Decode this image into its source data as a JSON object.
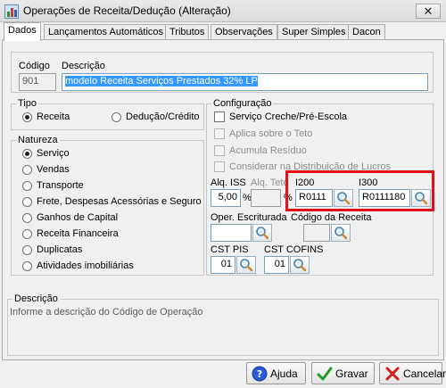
{
  "window": {
    "title": "Operações de Receita/Dedução (Alteração)",
    "close_glyph": "✕"
  },
  "tabs": [
    {
      "label": "Dados",
      "active": true
    },
    {
      "label": "Lançamentos Automáticos"
    },
    {
      "label": "Tributos"
    },
    {
      "label": "Observações"
    },
    {
      "label": "Super Simples"
    },
    {
      "label": "Dacon"
    }
  ],
  "header": {
    "codigo_label": "Código",
    "codigo_value": "901",
    "descricao_label": "Descrição",
    "descricao_value": "modelo Receita Serviços Prestados 32% LP"
  },
  "tipo": {
    "label": "Tipo",
    "options": [
      {
        "label": "Receita",
        "checked": true
      },
      {
        "label": "Dedução/Crédito",
        "checked": false
      }
    ]
  },
  "natureza": {
    "label": "Natureza",
    "options": [
      {
        "label": "Serviço",
        "checked": true
      },
      {
        "label": "Vendas"
      },
      {
        "label": "Transporte"
      },
      {
        "label": "Frete, Despesas Acessórias e Seguro"
      },
      {
        "label": "Ganhos de Capital"
      },
      {
        "label": "Receita Financeira"
      },
      {
        "label": "Duplicatas"
      },
      {
        "label": "Atividades imobiliárias"
      }
    ]
  },
  "configuracao": {
    "label": "Configuração",
    "checks": [
      {
        "label": "Serviço Creche/Pré-Escola",
        "enabled": true
      },
      {
        "label": "Aplica sobre o Teto",
        "enabled": false
      },
      {
        "label": "Acumula Resíduo",
        "enabled": false
      },
      {
        "label": "Considerar na Distribuição de Lucros",
        "enabled": false
      }
    ],
    "aliq_iss_label": "Alq. ISS",
    "aliq_iss_value": "5,00",
    "aliq_iss_unit": "%",
    "aliq_teto_label": "Alq. Teto",
    "aliq_teto_unit": "%",
    "i200_label": "I200",
    "i200_value": "R0111",
    "i300_label": "I300",
    "i300_value": "R0111180",
    "oper_escriturada_label": "Oper. Escriturada",
    "codigo_receita_label": "Código da Receita",
    "cst_pis_label": "CST PIS",
    "cst_pis_value": "01",
    "cst_cofins_label": "CST COFINS",
    "cst_cofins_value": "01"
  },
  "descricao_hint": {
    "label": "Descrição",
    "text": "Informe a descrição do Código de Operação"
  },
  "buttons": {
    "ajuda": "Ajuda",
    "gravar": "Gravar",
    "cancelar": "Cancelar"
  },
  "icons": {
    "search": "magnifier-icon",
    "help": "help-icon",
    "save": "checkmark-icon",
    "cancel": "x-icon"
  },
  "colors": {
    "highlight": "#e0101b",
    "selection": "#3399ff"
  }
}
